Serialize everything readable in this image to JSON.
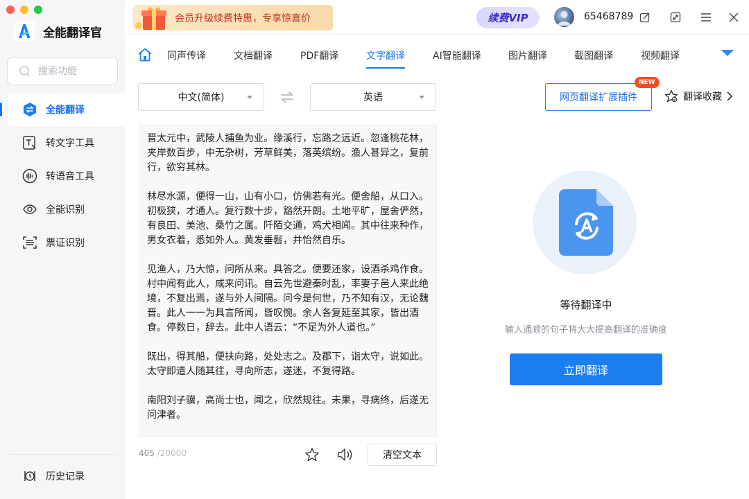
{
  "app": {
    "name": "全能翻译官"
  },
  "search": {
    "placeholder": "搜索功能"
  },
  "sidebar": {
    "items": [
      {
        "label": "全能翻译"
      },
      {
        "label": "转文字工具"
      },
      {
        "label": "转语音工具"
      },
      {
        "label": "全能识别"
      },
      {
        "label": "票证识别"
      }
    ],
    "history_label": "历史记录"
  },
  "topbar": {
    "promo_text": "会员升级续费特惠，专享惊喜价",
    "vip_label": "续费VIP",
    "username": "65468789"
  },
  "tabs": [
    {
      "label": "同声传译"
    },
    {
      "label": "文档翻译"
    },
    {
      "label": "PDF翻译"
    },
    {
      "label": "文字翻译"
    },
    {
      "label": "AI智能翻译"
    },
    {
      "label": "图片翻译"
    },
    {
      "label": "截图翻译"
    },
    {
      "label": "视频翻译"
    }
  ],
  "translator": {
    "source_lang": "中文(简体)",
    "target_lang": "英语",
    "paragraphs": [
      "晋太元中，武陵人捕鱼为业。缘溪行，忘路之远近。忽逢桃花林，夹岸数百步，中无杂树，芳草鲜美，落英缤纷。渔人甚异之，复前行，欲穷其林。",
      "林尽水源，便得一山，山有小口，仿佛若有光。便舍船，从口入。初极狭，才通人。复行数十步，豁然开朗。土地平旷，屋舍俨然，有良田、美池、桑竹之属。阡陌交通，鸡犬相闻。其中往来种作，男女衣着，悉如外人。黄发垂髫，并怡然自乐。",
      "见渔人，乃大惊，问所从来。具答之。便要还家，设酒杀鸡作食。村中闻有此人，咸来问讯。自云先世避秦时乱，率妻子邑人来此绝境，不复出焉，遂与外人间隔。问今是何世，乃不知有汉，无论魏晋。此人一一为具言所闻，皆叹惋。余人各复延至其家，皆出酒食。停数日，辞去。此中人语云：“不足为外人道也。”",
      "既出，得其船，便扶向路，处处志之。及郡下，诣太守，说如此。太守即遣人随其往，寻向所志，遂迷，不复得路。",
      "南阳刘子骥，高尚士也，闻之，欣然规往。未果，寻病终，后遂无问津者。"
    ],
    "char_count": "405",
    "char_max": "/20000",
    "clear_label": "清空文本"
  },
  "right_panel": {
    "extension_label": "网页翻译扩展插件",
    "new_badge": "NEW",
    "favorites_label": "翻译收藏",
    "wait_title": "等待翻译中",
    "wait_subtitle": "输入通顺的句子将大大提高翻译的准确度",
    "translate_label": "立即翻译"
  },
  "colors": {
    "accent": "#1a7ff0",
    "sidebar_bg": "#f5f6f8",
    "badge": "#f04c26",
    "promo_text": "#c0341d",
    "vip_text": "#3a2dbf"
  }
}
